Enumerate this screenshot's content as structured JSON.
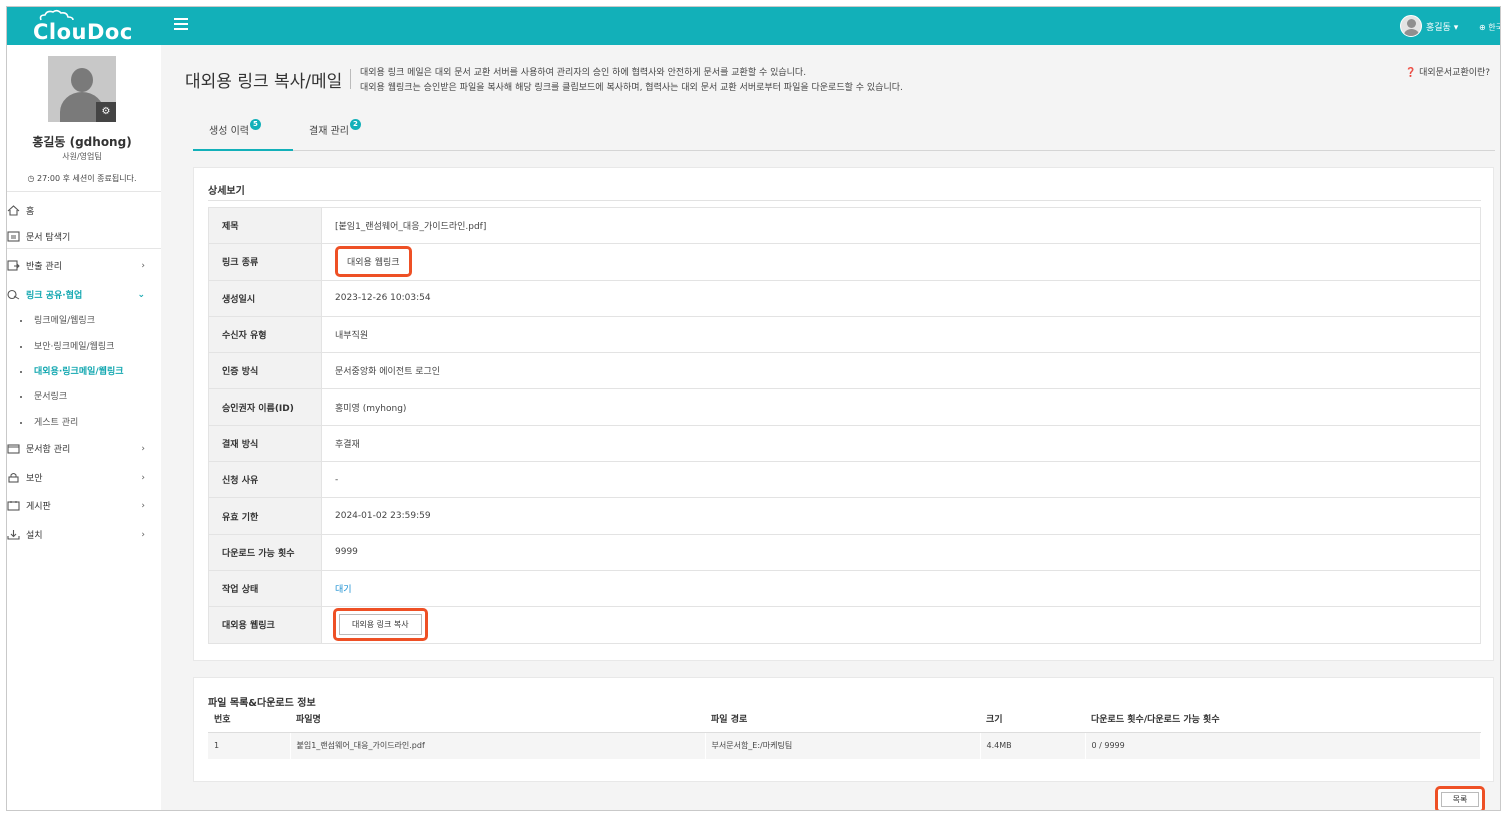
{
  "app": {
    "logo_text": "ClouDoc"
  },
  "header": {
    "user_label": "홍길동 ▾",
    "lang_label": "⊕ 한국"
  },
  "sidebar": {
    "name": "홍길동 (gdhong)",
    "dept": "사원/영업팀",
    "session": "◷ 27:00 후 세션이 종료됩니다.",
    "nav": [
      {
        "label": "홈"
      },
      {
        "label": "문서 탐색기"
      },
      {
        "label": "반출 관리"
      },
      {
        "label": "링크 공유·협업"
      },
      {
        "label": "문서함 관리"
      },
      {
        "label": "보안"
      },
      {
        "label": "게시판"
      },
      {
        "label": "설치"
      }
    ],
    "sub": [
      {
        "label": "링크메일/웹링크"
      },
      {
        "label": "보안·링크메일/웹링크"
      },
      {
        "label": "대외용·링크메일/웹링크"
      },
      {
        "label": "문서링크"
      },
      {
        "label": "게스트 관리"
      }
    ]
  },
  "main": {
    "title": "대외용 링크 복사/메일",
    "desc1": "대외용 링크 메일은 대외 문서 교환 서버를 사용하여 관리자의 승인 하에 협력사와 안전하게 문서를 교환할 수 있습니다.",
    "desc2": "대외용 웹링크는 승인받은 파일을 복사해 해당 링크를 클립보드에 복사하며, 협력사는 대외 문서 교환 서버로부터 파일을 다운로드할 수 있습니다.",
    "help": "❓ 대외문서교환이란?",
    "tabs": [
      {
        "label": "생성 이력",
        "badge": "5"
      },
      {
        "label": "결재 관리",
        "badge": "2"
      }
    ],
    "detail": {
      "title": "상세보기",
      "rows": [
        {
          "label": "제목",
          "value": "[붙임1_랜섬웨어_대응_가이드라인.pdf]"
        },
        {
          "label": "링크 종류",
          "value": "대외용 웹링크"
        },
        {
          "label": "생성일시",
          "value": "2023-12-26 10:03:54"
        },
        {
          "label": "수신자 유형",
          "value": "내부직원"
        },
        {
          "label": "인증 방식",
          "value": "문서중앙화 에이전트 로그인"
        },
        {
          "label": "승인권자 이름(ID)",
          "value": "홍미영 (myhong)"
        },
        {
          "label": "결재 방식",
          "value": "후결재"
        },
        {
          "label": "신청 사유",
          "value": "-"
        },
        {
          "label": "유효 기한",
          "value": "2024-01-02 23:59:59"
        },
        {
          "label": "다운로드 가능 횟수",
          "value": "9999"
        },
        {
          "label": "작업 상태",
          "value": "대기"
        },
        {
          "label": "대외용 웹링크",
          "value": "대외용 링크 복사"
        }
      ]
    },
    "files": {
      "title": "파일 목록&다운로드 정보",
      "columns": [
        "번호",
        "파일명",
        "파일 경로",
        "크기",
        "다운로드 횟수/다운로드 가능 횟수"
      ],
      "rows": [
        [
          "1",
          "붙임1_랜섬웨어_대응_가이드라인.pdf",
          "부서문서함_E:/마케팅팀",
          "4.4MB",
          "0 / 9999"
        ]
      ]
    },
    "list_button": "목록"
  },
  "colors": {
    "brand": "#12b0b9",
    "highlight": "#ee5025",
    "link": "#1a8fd2"
  }
}
